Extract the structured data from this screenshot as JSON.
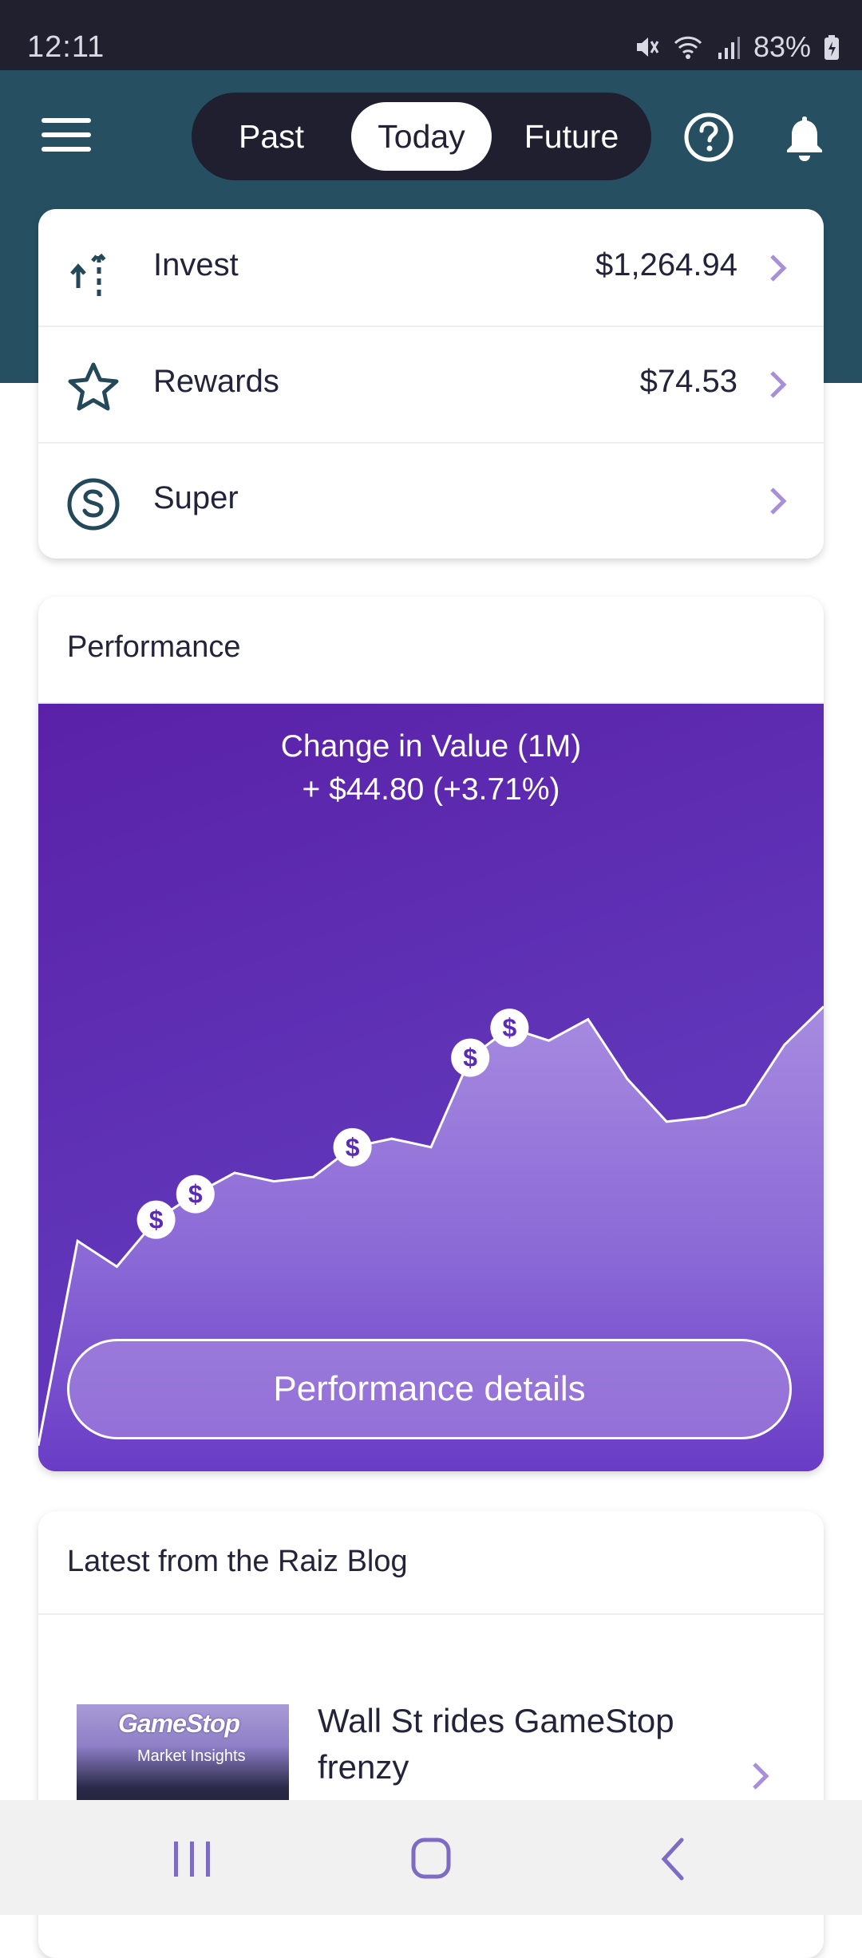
{
  "status_bar": {
    "time": "12:11",
    "battery": "83%"
  },
  "header": {
    "tabs": [
      {
        "label": "Past",
        "active": false
      },
      {
        "label": "Today",
        "active": true
      },
      {
        "label": "Future",
        "active": false
      }
    ],
    "icons": [
      "menu-icon",
      "help-icon",
      "bell-icon"
    ]
  },
  "accounts": [
    {
      "label": "Invest",
      "value": "$1,264.94",
      "icon": "invest-arrows-icon"
    },
    {
      "label": "Rewards",
      "value": "$74.53",
      "icon": "star-icon"
    },
    {
      "label": "Super",
      "value": "",
      "icon": "super-s-icon"
    }
  ],
  "performance": {
    "title": "Performance",
    "change_label": "Change in Value (1M)",
    "change_value": "+ $44.80 (+3.71%)",
    "button_label": "Performance details",
    "colors": {
      "chart_top": "#5a21a8",
      "chart_fill": "#a78be0",
      "accent": "#5b2bb5"
    }
  },
  "chart_data": {
    "type": "area",
    "values": [
      0.3,
      2.7,
      2.4,
      2.95,
      3.25,
      3.5,
      3.4,
      3.45,
      3.8,
      3.9,
      3.8,
      4.85,
      5.2,
      5.05,
      5.3,
      4.6,
      4.1,
      4.15,
      4.3,
      5.0,
      5.45
    ],
    "markers": [
      3,
      4,
      8,
      11,
      12
    ],
    "marker_symbol": "$",
    "ylim": [
      0,
      9
    ]
  },
  "blog": {
    "title": "Latest from the Raiz Blog",
    "items": [
      {
        "headline": "Wall St rides GameStop frenzy",
        "thumb_logo": "GameStop",
        "thumb_caption": "Market Insights"
      }
    ]
  },
  "nav": [
    "recent-apps-icon",
    "home-icon",
    "back-icon"
  ]
}
